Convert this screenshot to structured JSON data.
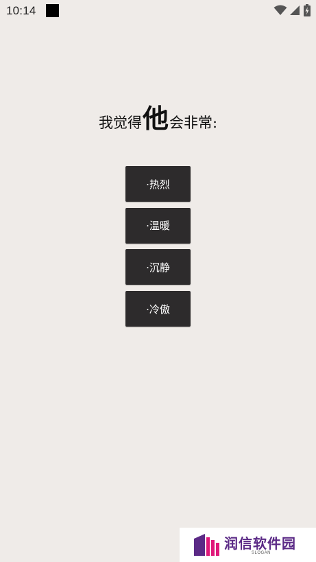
{
  "status_bar": {
    "time": "10:14",
    "icons": [
      "notification-square-icon",
      "wifi-icon",
      "cellular-signal-icon",
      "battery-charging-icon"
    ]
  },
  "question": {
    "prefix": "我觉得",
    "emphasis": "他",
    "suffix": "会非常:"
  },
  "options": [
    {
      "label": "·热烈"
    },
    {
      "label": "·温暖"
    },
    {
      "label": "·沉静"
    },
    {
      "label": "·冷傲"
    }
  ],
  "watermark": {
    "brand": "润信软件园",
    "slogan": "SLOGAN"
  },
  "colors": {
    "background": "#efebe8",
    "button": "#2d2b2c",
    "button_text": "#ffffff",
    "brand": "#5b2a86"
  }
}
